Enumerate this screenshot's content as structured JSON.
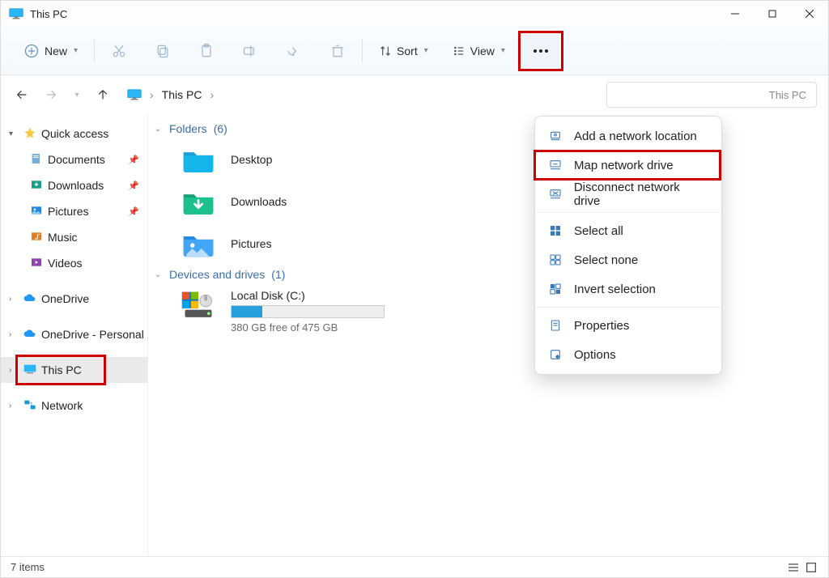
{
  "window": {
    "title": "This PC"
  },
  "toolbar": {
    "new": "New",
    "sort": "Sort",
    "view": "View"
  },
  "address": {
    "crumb": "This PC"
  },
  "search": {
    "placeholder": "Search This PC",
    "visible_tail": "This PC"
  },
  "sidebar": {
    "quick_access": "Quick access",
    "items": [
      {
        "label": "Documents"
      },
      {
        "label": "Downloads"
      },
      {
        "label": "Pictures"
      },
      {
        "label": "Music"
      },
      {
        "label": "Videos"
      }
    ],
    "onedrive": "OneDrive",
    "onedrive_personal": "OneDrive - Personal",
    "this_pc": "This PC",
    "network": "Network"
  },
  "content": {
    "groups": {
      "folders": {
        "label": "Folders",
        "count": "(6)"
      },
      "drives": {
        "label": "Devices and drives",
        "count": "(1)"
      }
    },
    "folders": [
      {
        "label": "Desktop"
      },
      {
        "label": "Downloads"
      },
      {
        "label": "Pictures"
      }
    ],
    "drive": {
      "label": "Local Disk (C:)",
      "free": "380 GB free of 475 GB",
      "fill_pct": 20
    }
  },
  "menu": {
    "items": [
      "Add a network location",
      "Map network drive",
      "Disconnect network drive",
      "Select all",
      "Select none",
      "Invert selection",
      "Properties",
      "Options"
    ]
  },
  "status": {
    "text": "7 items"
  }
}
